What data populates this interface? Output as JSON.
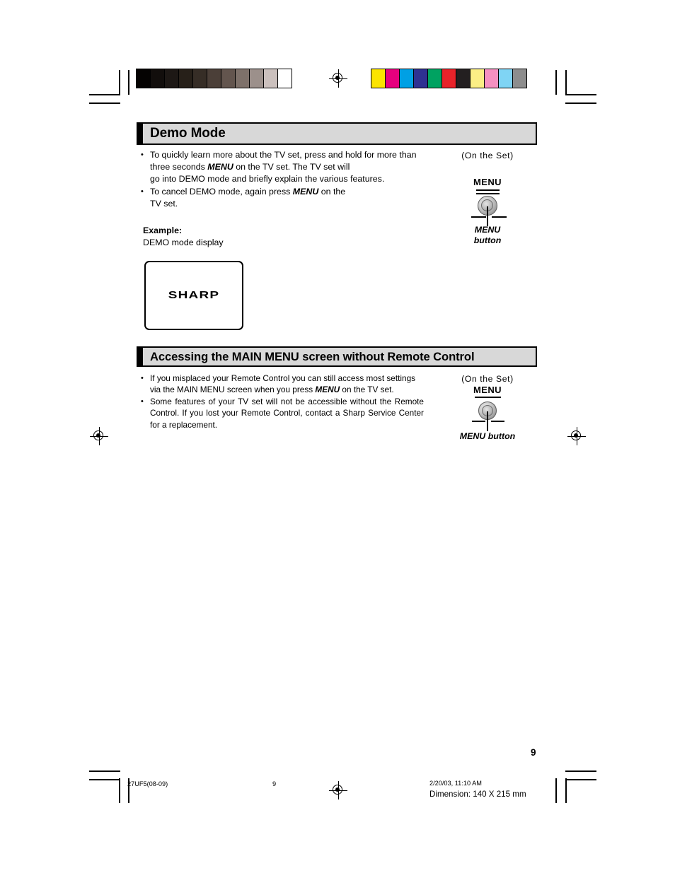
{
  "page": {
    "number": "9",
    "footer_job": "27UF5(08-09)",
    "footer_page": "9",
    "footer_timestamp": "2/20/03, 11:10 AM",
    "footer_dimension": "Dimension: 140  X 215 mm"
  },
  "calibration": {
    "grayscale_label": "grayscale-calibration-bar",
    "grayscale_swatches": [
      "#050302",
      "#120e0c",
      "#1d1815",
      "#272019",
      "#362d26",
      "#4b3f38",
      "#63554e",
      "#7e716a",
      "#9c908b",
      "#cbc0bd",
      "#ffffff"
    ],
    "color_label": "color-calibration-bar",
    "color_swatches": [
      "#fbe400",
      "#e6007e",
      "#00a0e4",
      "#2e3192",
      "#00a261",
      "#e8232a",
      "#231f20",
      "#fbef85",
      "#f591c1",
      "#7fd4f4",
      "#8d8d8d"
    ]
  },
  "sections": [
    {
      "id": "demo-mode",
      "title": "Demo Mode",
      "bullets": [
        {
          "parts": [
            {
              "text": "To quickly learn more about the TV set, press and hold for more than three seconds ",
              "style": "normal"
            },
            {
              "text": "MENU",
              "style": "bold-italic"
            },
            {
              "text": "  on the TV set. The TV set will",
              "style": "normal"
            }
          ],
          "line1": "To quickly learn more about the TV set, press and hold for more than",
          "line2_pre": "three seconds ",
          "line2_bold": "MENU",
          "line2_post": "  on the TV set. The TV set will",
          "line3": "go into DEMO mode and briefly explain the various features."
        },
        {
          "line1_pre": "To cancel DEMO mode, again press ",
          "line1_bold": "MENU",
          "line1_post": "  on the",
          "line2": "TV set."
        }
      ],
      "example_label": "Example:",
      "example_sub": "DEMO mode display",
      "screen_logo": "SHARP",
      "onset": {
        "caption": "(On the Set)",
        "menu_label": "MENU",
        "button_text_line1": "MENU",
        "button_text_line2": "button"
      }
    },
    {
      "id": "accessing-main-menu",
      "title": "Accessing the MAIN MENU screen without Remote Control",
      "bullets": [
        {
          "line1": "If you misplaced your Remote Control you can still access most settings",
          "line2_pre": "via the MAIN MENU screen when you press ",
          "line2_bold": "MENU",
          "line2_post": " on the TV set."
        },
        {
          "text": "Some features of your TV set will not be accessible without the Remote Control. If you lost your Remote Control, contact a Sharp Service Center for a replacement."
        }
      ],
      "onset": {
        "caption": "(On the Set)",
        "menu_label": "MENU",
        "button_text": "MENU  button"
      }
    }
  ]
}
